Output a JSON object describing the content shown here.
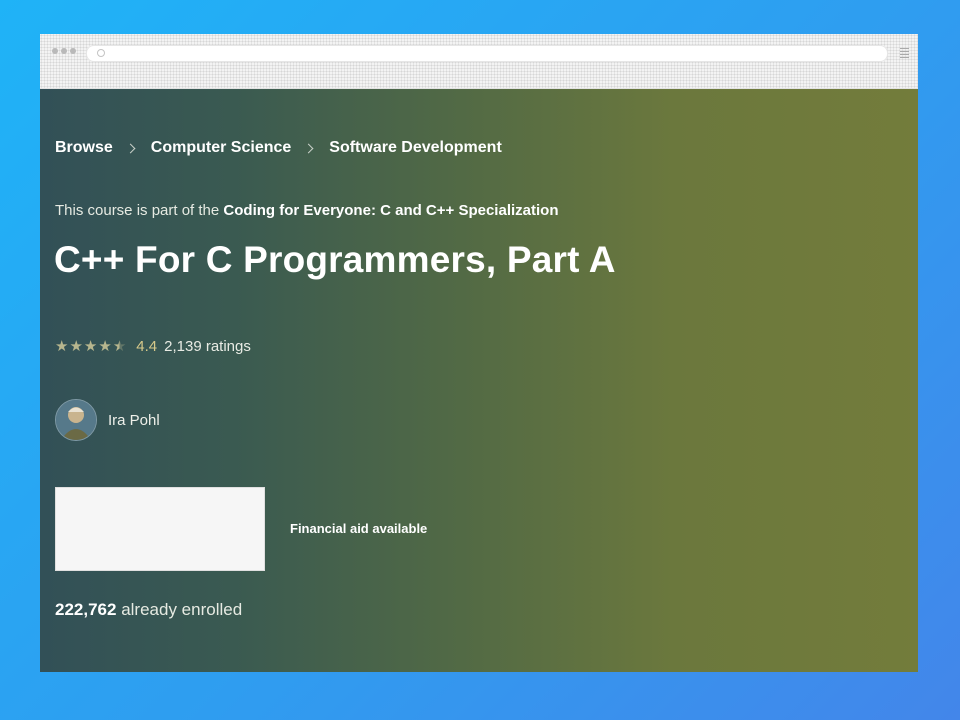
{
  "browser": {
    "icons": {
      "window_controls": "three-dots-icon",
      "address_lens": "search-icon",
      "menu": "hamburger-menu-icon"
    }
  },
  "breadcrumb": {
    "items": [
      {
        "label": "Browse"
      },
      {
        "label": "Computer Science"
      },
      {
        "label": "Software Development"
      }
    ],
    "separator_icon": "chevron-right-icon"
  },
  "course": {
    "specialization_prefix": "This course is part of the",
    "specialization_name": "Coding for Everyone: C and C++ Specialization",
    "title": "C++ For C Programmers, Part A",
    "rating": {
      "value": "4.4",
      "stars_filled": 4.5,
      "stars_total": 5,
      "count_label": "2,139 ratings"
    },
    "instructor": {
      "name": "Ira Pohl",
      "avatar_icon": "instructor-avatar"
    },
    "financial_aid": "Financial aid available",
    "enrolled": {
      "count": "222,762",
      "suffix": "already enrolled"
    }
  },
  "colors": {
    "background": "#1fb3f7",
    "hero_left": "#325057",
    "hero_right": "#737c3b",
    "star": "#b7b68e",
    "rating_value": "#d6c98a"
  }
}
